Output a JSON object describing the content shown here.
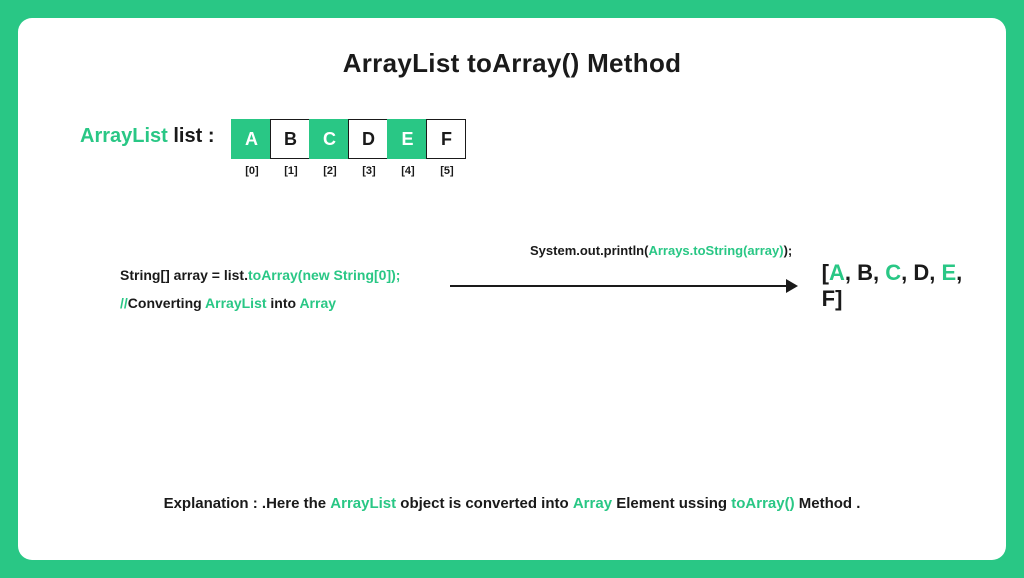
{
  "title": "ArrayList toArray() Method",
  "list_label_accent": "ArrayList",
  "list_label_rest": " list :",
  "cells": [
    {
      "val": "A",
      "idx": "[0]",
      "hl": true
    },
    {
      "val": "B",
      "idx": "[1]",
      "hl": false
    },
    {
      "val": "C",
      "idx": "[2]",
      "hl": true
    },
    {
      "val": "D",
      "idx": "[3]",
      "hl": false
    },
    {
      "val": "E",
      "idx": "[4]",
      "hl": true
    },
    {
      "val": "F",
      "idx": "[5]",
      "hl": false
    }
  ],
  "code1_a": "String[] array = list.",
  "code1_b": "toArray(new String[0]);",
  "code2_a": "//",
  "code2_b": "Converting ",
  "code2_c": "ArrayList",
  "code2_d": " into ",
  "code2_e": "Array",
  "print_a": "System.out.println(",
  "print_b": "Arrays.toString(array)",
  "print_c": ");",
  "result_open": "[",
  "result_items": [
    {
      "t": "A",
      "hl": true
    },
    {
      "t": "B",
      "hl": false
    },
    {
      "t": "C",
      "hl": true
    },
    {
      "t": "D",
      "hl": false
    },
    {
      "t": "E",
      "hl": true
    },
    {
      "t": "F",
      "hl": false
    }
  ],
  "result_close": "]",
  "expl_label": "Explanation :",
  "expl_1": " .Here the ",
  "expl_2": "ArrayList",
  "expl_3": "  object is   converted into ",
  "expl_4": "Array",
  "expl_5": " Element ussing ",
  "expl_6": "toArray()",
  "expl_7": " Method ."
}
